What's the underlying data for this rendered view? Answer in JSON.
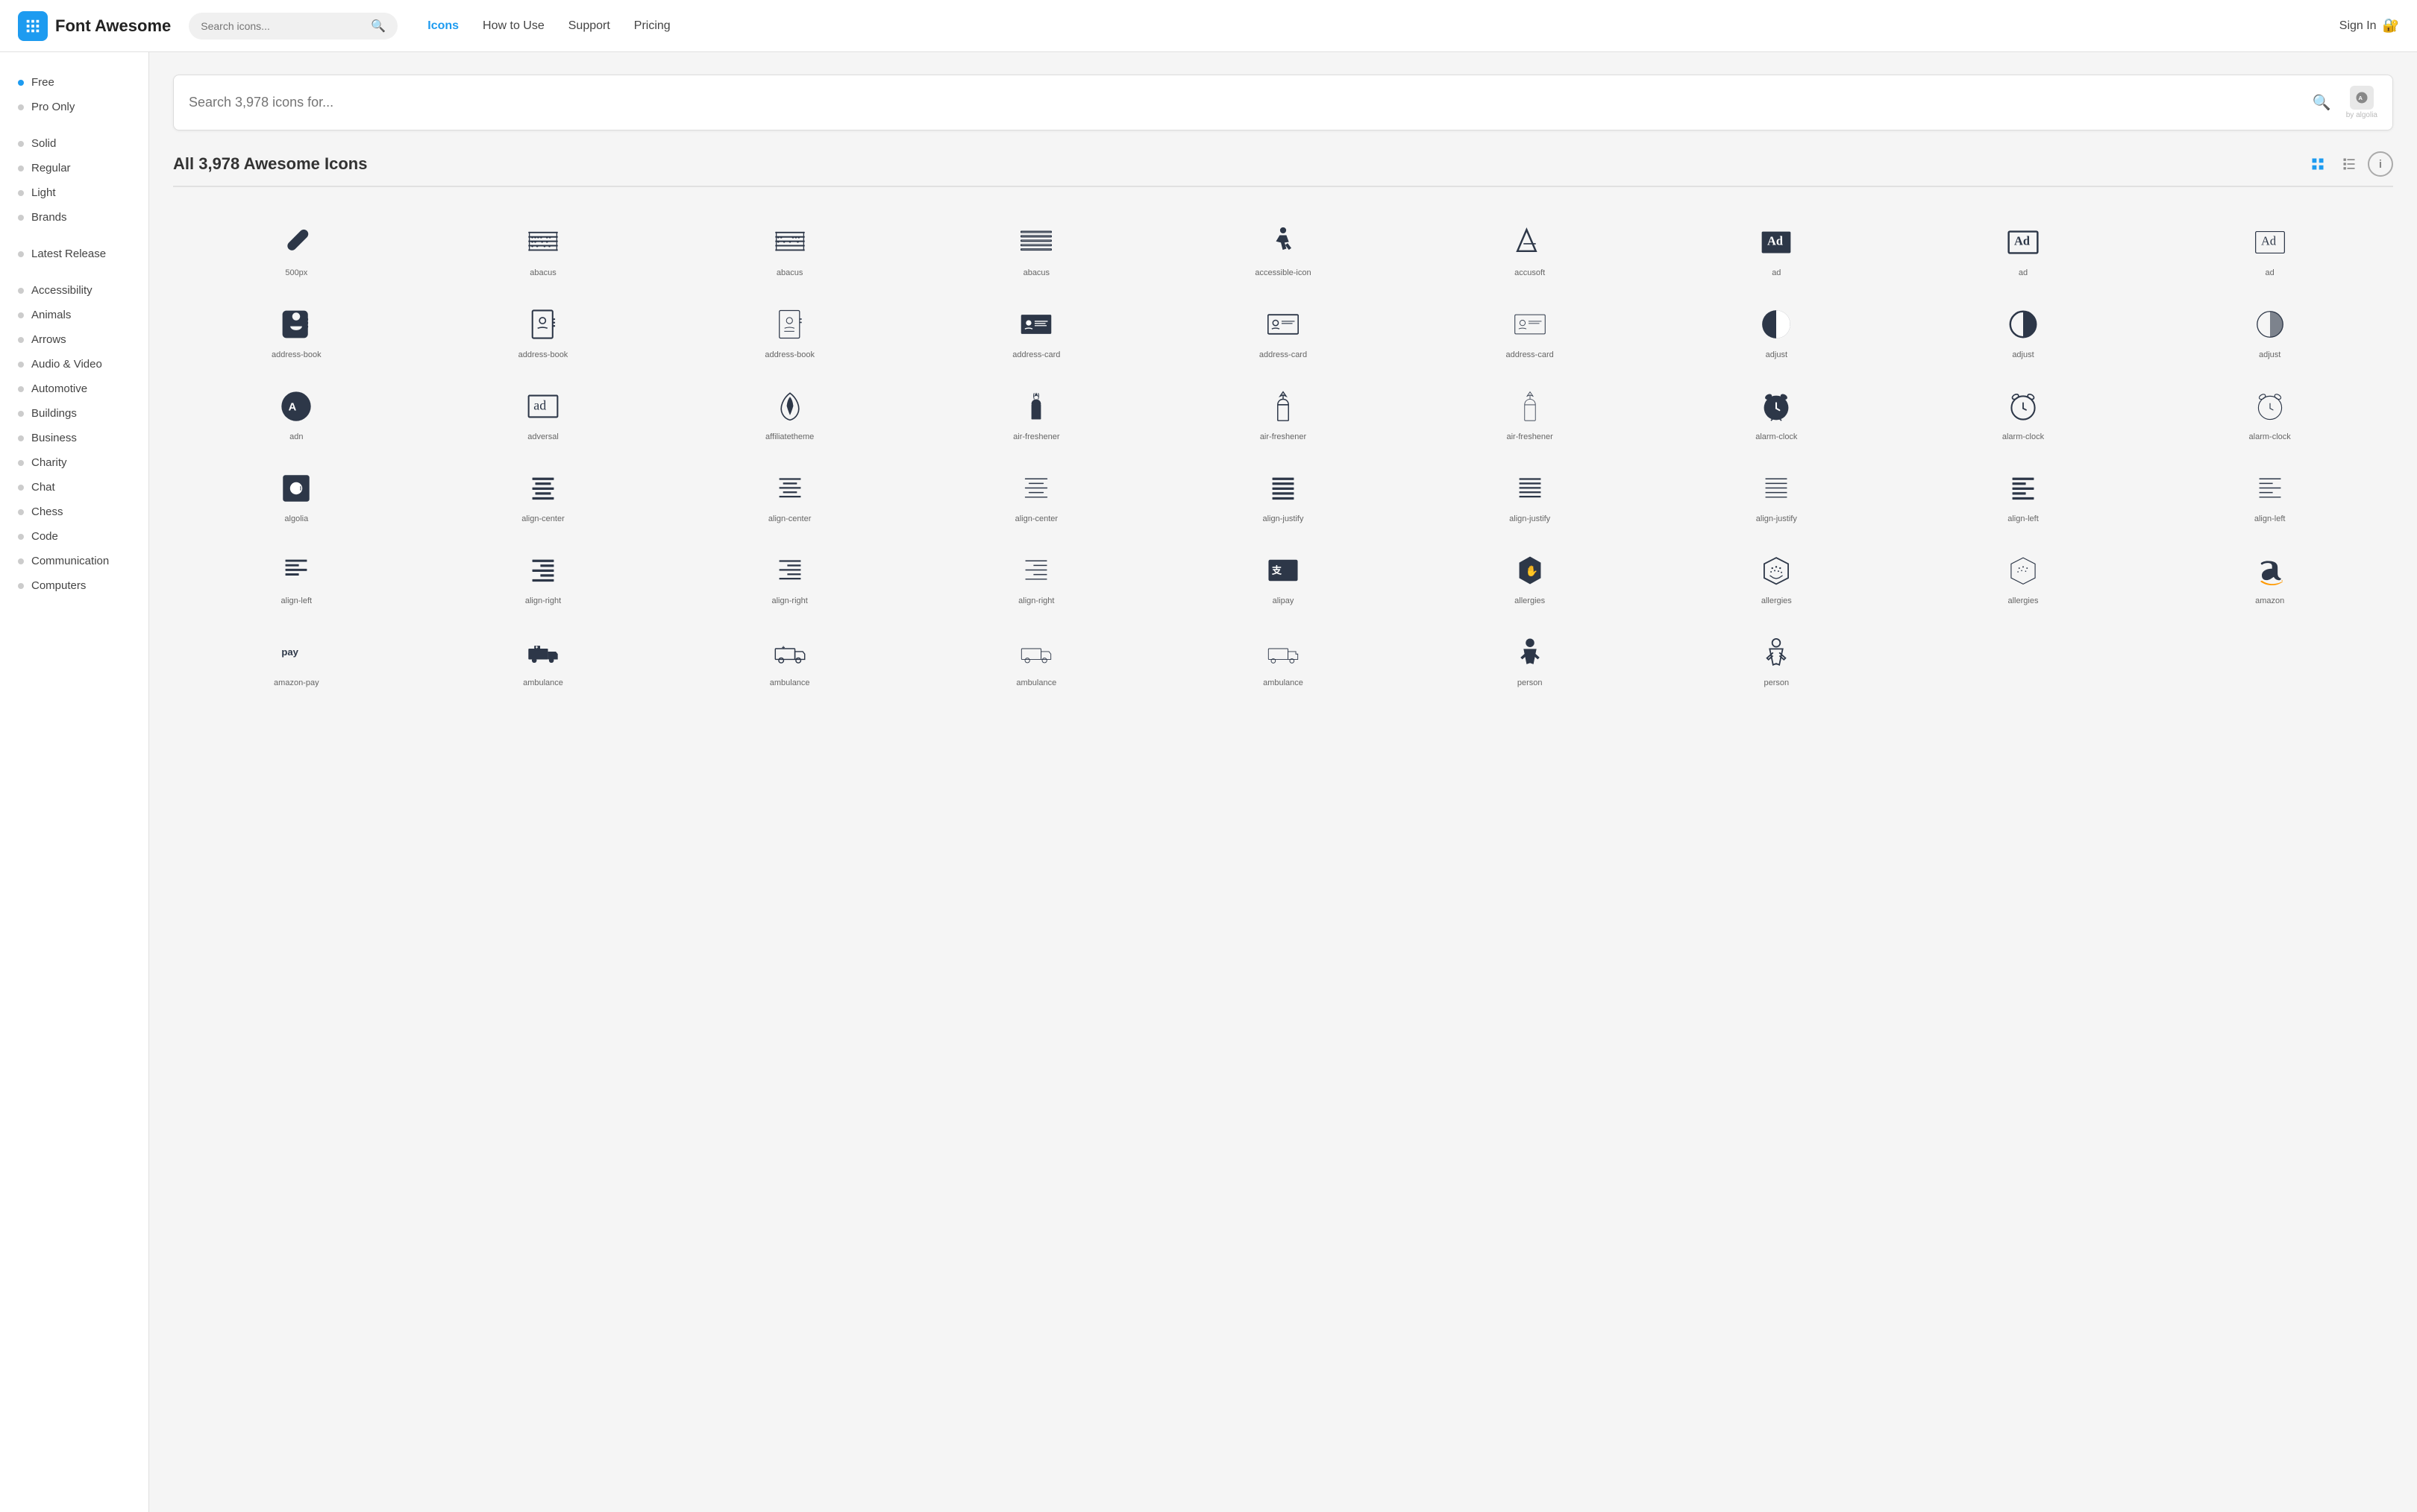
{
  "header": {
    "logo_icon": "F",
    "logo_text": "Font Awesome",
    "search_placeholder": "Search icons...",
    "nav_items": [
      {
        "label": "Icons",
        "active": true,
        "key": "icons"
      },
      {
        "label": "How to Use",
        "active": false,
        "key": "how-to-use"
      },
      {
        "label": "Support",
        "active": false,
        "key": "support"
      },
      {
        "label": "Pricing",
        "active": false,
        "key": "pricing"
      }
    ],
    "sign_in": "Sign In"
  },
  "main_search": {
    "placeholder": "Search 3,978 icons for...",
    "algolia_label": "by algolia"
  },
  "section": {
    "title": "All 3,978 Awesome Icons"
  },
  "sidebar": {
    "filter_groups": [
      {
        "label": "Free",
        "dot": "active",
        "key": "free"
      },
      {
        "label": "Pro Only",
        "dot": "default",
        "key": "pro-only"
      }
    ],
    "style_groups": [
      {
        "label": "Solid",
        "dot": "default",
        "key": "solid"
      },
      {
        "label": "Regular",
        "dot": "default",
        "key": "regular"
      },
      {
        "label": "Light",
        "dot": "default",
        "key": "light"
      },
      {
        "label": "Brands",
        "dot": "default",
        "key": "brands"
      }
    ],
    "other_groups": [
      {
        "label": "Latest Release",
        "dot": "default",
        "key": "latest-release"
      }
    ],
    "category_groups": [
      {
        "label": "Accessibility",
        "dot": "default",
        "key": "accessibility"
      },
      {
        "label": "Animals",
        "dot": "default",
        "key": "animals"
      },
      {
        "label": "Arrows",
        "dot": "default",
        "key": "arrows"
      },
      {
        "label": "Audio & Video",
        "dot": "default",
        "key": "audio-video"
      },
      {
        "label": "Automotive",
        "dot": "default",
        "key": "automotive"
      },
      {
        "label": "Buildings",
        "dot": "default",
        "key": "buildings"
      },
      {
        "label": "Business",
        "dot": "default",
        "key": "business"
      },
      {
        "label": "Charity",
        "dot": "default",
        "key": "charity"
      },
      {
        "label": "Chat",
        "dot": "default",
        "key": "chat"
      },
      {
        "label": "Chess",
        "dot": "default",
        "key": "chess"
      },
      {
        "label": "Code",
        "dot": "default",
        "key": "code"
      },
      {
        "label": "Communication",
        "dot": "default",
        "key": "communication"
      },
      {
        "label": "Computers",
        "dot": "default",
        "key": "computers"
      }
    ]
  },
  "icons": [
    {
      "label": "500px",
      "shape": "500px"
    },
    {
      "label": "abacus",
      "shape": "abacus"
    },
    {
      "label": "abacus",
      "shape": "abacus"
    },
    {
      "label": "abacus",
      "shape": "abacus"
    },
    {
      "label": "accessible-icon",
      "shape": "accessible-icon"
    },
    {
      "label": "accusoft",
      "shape": "accusoft"
    },
    {
      "label": "ad",
      "shape": "ad-solid"
    },
    {
      "label": "ad",
      "shape": "ad-regular"
    },
    {
      "label": "ad",
      "shape": "ad-outline"
    },
    {
      "label": "address-book",
      "shape": "address-book-solid"
    },
    {
      "label": "address-book",
      "shape": "address-book-reg"
    },
    {
      "label": "address-book",
      "shape": "address-book-light"
    },
    {
      "label": "address-card",
      "shape": "address-card-solid"
    },
    {
      "label": "address-card",
      "shape": "address-card-reg"
    },
    {
      "label": "address-card",
      "shape": "address-card-light"
    },
    {
      "label": "adjust",
      "shape": "adjust-solid"
    },
    {
      "label": "adjust",
      "shape": "adjust-reg"
    },
    {
      "label": "adjust",
      "shape": "adjust-light"
    },
    {
      "label": "adn",
      "shape": "adn"
    },
    {
      "label": "adversal",
      "shape": "adversal"
    },
    {
      "label": "affiliatetheme",
      "shape": "affiliatetheme"
    },
    {
      "label": "air-freshener",
      "shape": "air-freshener-solid"
    },
    {
      "label": "air-freshener",
      "shape": "air-freshener-reg"
    },
    {
      "label": "air-freshener",
      "shape": "air-freshener-light"
    },
    {
      "label": "alarm-clock",
      "shape": "alarm-clock-solid"
    },
    {
      "label": "alarm-clock",
      "shape": "alarm-clock-reg"
    },
    {
      "label": "alarm-clock",
      "shape": "alarm-clock-light"
    },
    {
      "label": "algolia",
      "shape": "algolia"
    },
    {
      "label": "align-center",
      "shape": "align-center-solid"
    },
    {
      "label": "align-center",
      "shape": "align-center-reg"
    },
    {
      "label": "align-center",
      "shape": "align-center-light"
    },
    {
      "label": "align-justify",
      "shape": "align-justify-solid"
    },
    {
      "label": "align-justify",
      "shape": "align-justify-reg"
    },
    {
      "label": "align-justify",
      "shape": "align-justify-light"
    },
    {
      "label": "align-left",
      "shape": "align-left-solid"
    },
    {
      "label": "align-left",
      "shape": "align-left-light"
    },
    {
      "label": "align-left",
      "shape": "align-left-solid"
    },
    {
      "label": "align-right",
      "shape": "align-right-solid"
    },
    {
      "label": "align-right",
      "shape": "align-right-reg"
    },
    {
      "label": "align-right",
      "shape": "align-right-light"
    },
    {
      "label": "alipay",
      "shape": "alipay"
    },
    {
      "label": "allergies",
      "shape": "allergies-solid"
    },
    {
      "label": "allergies",
      "shape": "allergies-reg"
    },
    {
      "label": "allergies",
      "shape": "allergies-light"
    },
    {
      "label": "amazon",
      "shape": "amazon"
    },
    {
      "label": "amazon-pay",
      "shape": "amazon-pay"
    },
    {
      "label": "ambulance",
      "shape": "ambulance"
    },
    {
      "label": "ambulance",
      "shape": "ambulance"
    },
    {
      "label": "ambulance",
      "shape": "ambulance"
    },
    {
      "label": "ambulance",
      "shape": "ambulance"
    },
    {
      "label": "person",
      "shape": "person"
    },
    {
      "label": "person",
      "shape": "person"
    }
  ]
}
